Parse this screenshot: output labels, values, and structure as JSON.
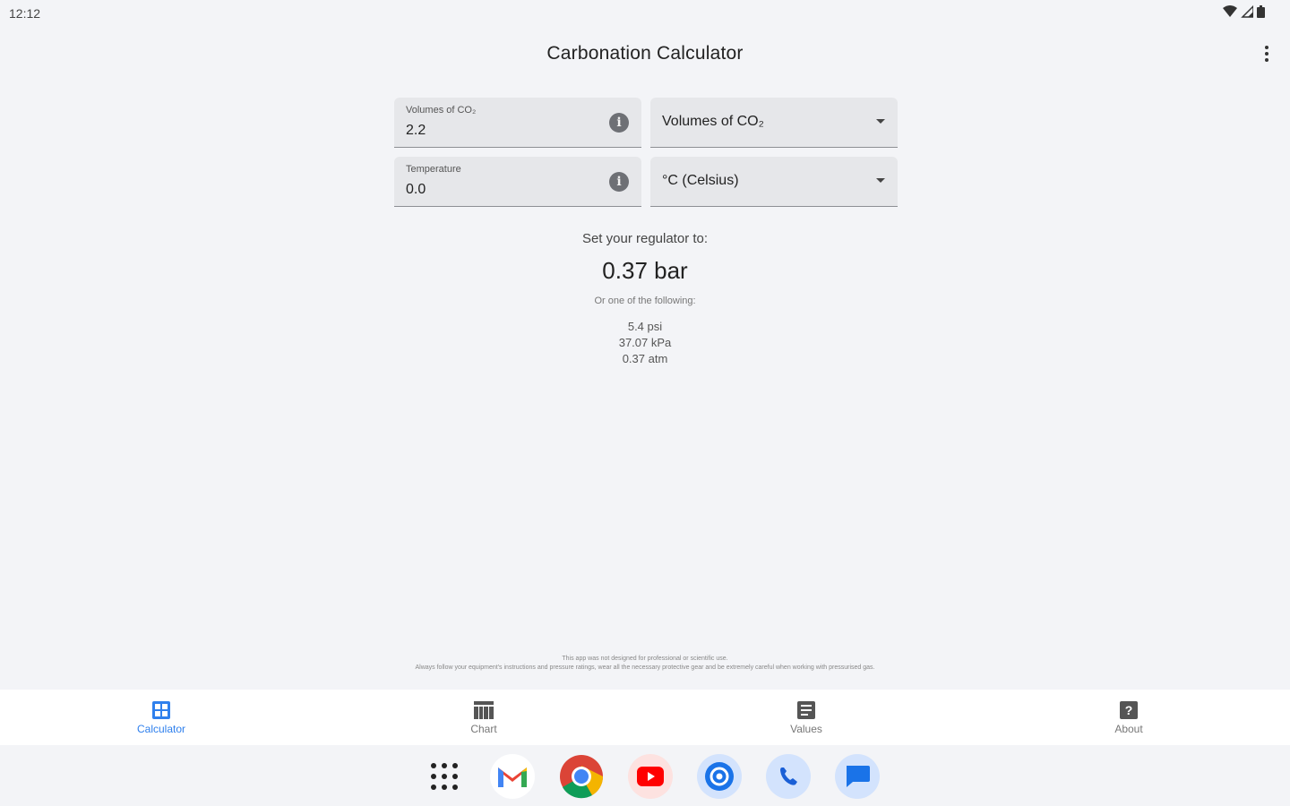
{
  "status_bar": {
    "time": "12:12"
  },
  "app_bar": {
    "title": "Carbonation Calculator"
  },
  "form": {
    "volumes_field": {
      "label": "Volumes of CO₂",
      "value": "2.2"
    },
    "volumes_unit": {
      "selected": "Volumes of CO₂"
    },
    "temperature_field": {
      "label": "Temperature",
      "value": "0.0"
    },
    "temperature_unit": {
      "selected": "°C (Celsius)"
    }
  },
  "result": {
    "prompt": "Set your regulator to:",
    "main": "0.37 bar",
    "alt_label": "Or one of the following:",
    "alternatives": [
      "5.4 psi",
      "37.07 kPa",
      "0.37 atm"
    ]
  },
  "disclaimer": {
    "line1": "This app was not designed for professional or scientific use.",
    "line2": "Always follow your equipment's instructions and pressure ratings, wear all the necessary protective gear and be extremely careful when working with pressurised gas."
  },
  "bottom_nav": {
    "active_color": "#2f80ed",
    "items": [
      {
        "label": "Calculator",
        "icon": "calculator-icon"
      },
      {
        "label": "Chart",
        "icon": "chart-table-icon"
      },
      {
        "label": "Values",
        "icon": "values-list-icon"
      },
      {
        "label": "About",
        "icon": "help-icon"
      }
    ]
  },
  "dock": {
    "apps": [
      "app-drawer-icon",
      "gmail-icon",
      "chrome-icon",
      "youtube-icon",
      "settings-icon",
      "phone-icon",
      "messages-icon"
    ]
  }
}
